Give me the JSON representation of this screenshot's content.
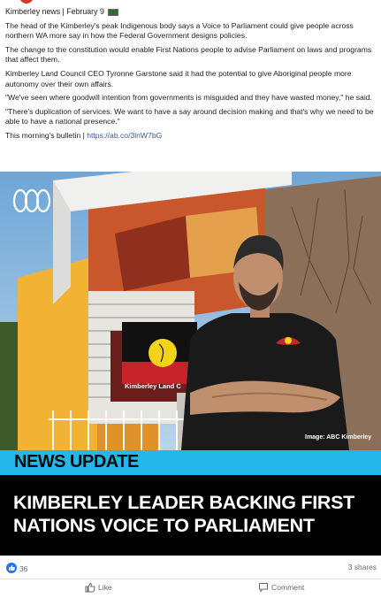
{
  "post": {
    "page_name": "Kimberley news",
    "separator": "|",
    "date": "February 9",
    "paragraphs": [
      "The head of the Kimberley's peak Indigenous body says a Voice to Parliament could give people across northern WA more say in how the Federal Government designs policies.",
      "The change to the constitution would enable First Nations people to advise Parliament on laws and programs that affect them.",
      "Kimberley Land Council CEO Tyronne Garstone said it had the potential to give Aboriginal people more autonomy over their own affairs.",
      "\"We've seen where goodwill intention from governments is misguided and they have wasted money,\" he said.",
      "\"There's duplication of services. We want to have a say around decision making and that's why we need to be able to have a national presence.\""
    ],
    "bulletin_label": "This morning's bulletin |",
    "bulletin_link": "https://ab.co/3lnW7bG"
  },
  "media": {
    "building_sign": "Kimberley Land C",
    "credit": "Image: ABC Kimberley",
    "banner_label": "NEWS UPDATE",
    "headline_line1": "KIMBERLEY LEADER BACKING FIRST",
    "headline_line2": "NATIONS VOICE TO PARLIAMENT",
    "colors": {
      "banner": "#23b8e8",
      "headline_bg": "#000000"
    }
  },
  "stats": {
    "reactions": "36",
    "shares": "3 shares"
  },
  "actions": {
    "like": "Like",
    "comment": "Comment"
  },
  "icons": [
    "abc-logo-icon",
    "like-reaction-icon",
    "thumbs-up-icon",
    "comment-icon",
    "flag-icon"
  ]
}
